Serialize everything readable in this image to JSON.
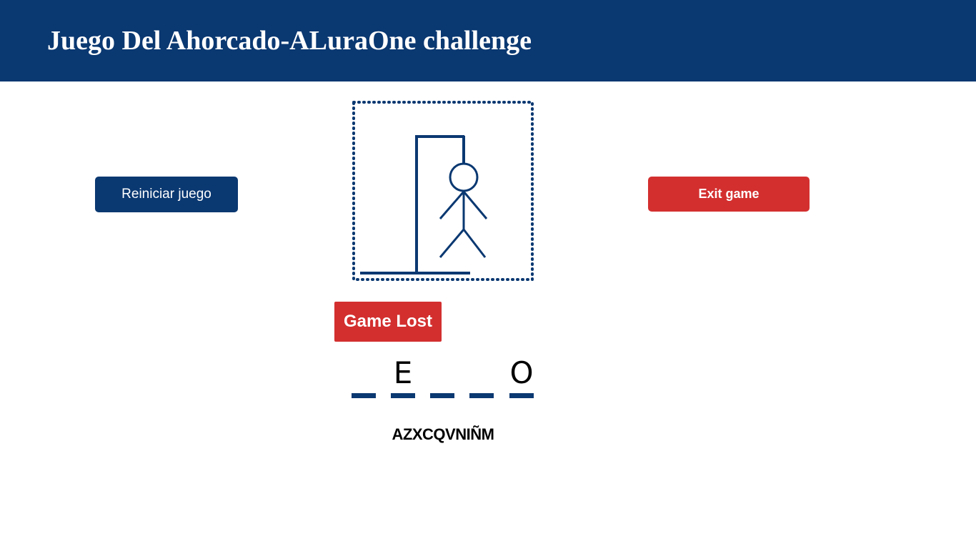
{
  "header": {
    "title": "Juego Del Ahorcado-ALuraOne challenge"
  },
  "controls": {
    "restart_label": "Reiniciar juego",
    "exit_label": "Exit game"
  },
  "game": {
    "status": "Game Lost",
    "word_slots": [
      "",
      "E",
      "",
      "",
      "O"
    ],
    "wrong_letters": "AZXCQVNIÑM"
  },
  "colors": {
    "primary": "#0a3871",
    "danger": "#d32f2f",
    "background": "#ffffff"
  }
}
